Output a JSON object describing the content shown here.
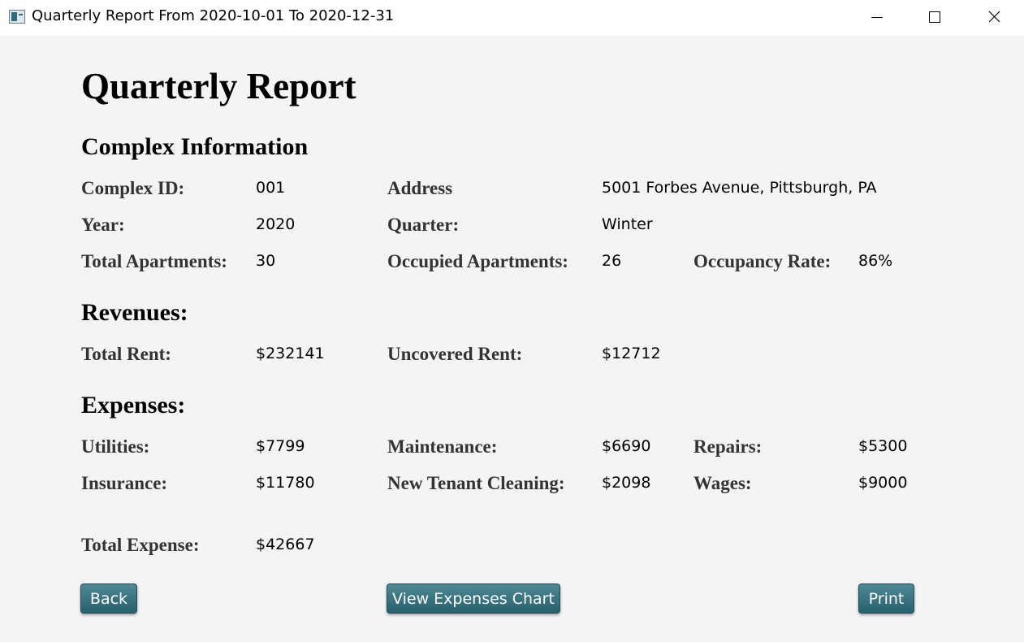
{
  "window": {
    "title": "Quarterly Report From 2020-10-01 To 2020-12-31"
  },
  "report": {
    "title": "Quarterly Report",
    "complex_section": "Complex Information",
    "complex_id_label": "Complex ID:",
    "complex_id": "001",
    "address_label": "Address",
    "address": "5001 Forbes Avenue, Pittsburgh, PA",
    "year_label": "Year:",
    "year": "2020",
    "quarter_label": "Quarter:",
    "quarter": "Winter",
    "total_apartments_label": "Total Apartments:",
    "total_apartments": "30",
    "occupied_apartments_label": "Occupied Apartments:",
    "occupied_apartments": "26",
    "occupancy_rate_label": "Occupancy Rate:",
    "occupancy_rate": "86%",
    "revenues_section": "Revenues:",
    "total_rent_label": "Total Rent:",
    "total_rent": "$232141",
    "uncovered_rent_label": "Uncovered Rent:",
    "uncovered_rent": "$12712",
    "expenses_section": "Expenses:",
    "utilities_label": "Utilities:",
    "utilities": "$7799",
    "maintenance_label": "Maintenance:",
    "maintenance": "$6690",
    "repairs_label": "Repairs:",
    "repairs": "$5300",
    "insurance_label": "Insurance:",
    "insurance": "$11780",
    "cleaning_label": "New Tenant Cleaning:",
    "cleaning": "$2098",
    "wages_label": "Wages:",
    "wages": "$9000",
    "total_expense_label": "Total Expense:",
    "total_expense": "$42667"
  },
  "buttons": {
    "back": "Back",
    "view_chart": "View Expenses Chart",
    "print": "Print"
  },
  "colors": {
    "button_top": "#4f8995",
    "button_bottom": "#28606d",
    "background": "#f4f4f4"
  }
}
